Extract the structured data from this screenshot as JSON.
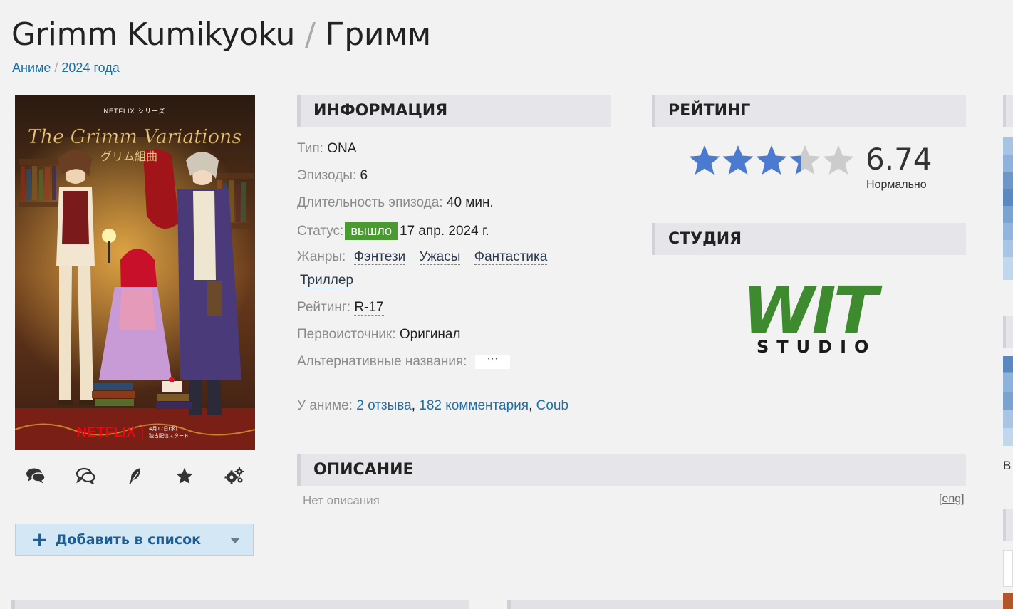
{
  "header": {
    "title_original": "Grimm Kumikyoku",
    "title_separator": "/",
    "title_russian": "Гримм",
    "breadcrumbs": [
      {
        "label": "Аниме"
      },
      {
        "label": "2024 года"
      }
    ],
    "breadcrumb_separator": "/"
  },
  "poster": {
    "label_top": "NETFLIX シリーズ",
    "logo_text": "The Grimm Variations",
    "logo_jp": "グリム組曲",
    "brand": "NETFLIX",
    "date_jp_line1": "4月17日(水)",
    "date_jp_line2": "独占配信スタート"
  },
  "actions": {
    "icons": [
      "comments-icon",
      "discussion-icon",
      "feather-icon",
      "star-icon",
      "gears-icon"
    ],
    "add_button": "Добавить в список"
  },
  "info": {
    "heading": "ИНФОРМАЦИЯ",
    "type_label": "Тип:",
    "type_value": "ONA",
    "episodes_label": "Эпизоды:",
    "episodes_value": "6",
    "duration_label": "Длительность эпизода:",
    "duration_value": "40 мин.",
    "status_label": "Статус:",
    "status_badge": "вышло",
    "status_date": "17 апр. 2024 г.",
    "genres_label": "Жанры:",
    "genres": [
      "Фэнтези",
      "Ужасы",
      "Фантастика",
      "Триллер"
    ],
    "rating_label": "Рейтинг:",
    "rating_value": "R-17",
    "source_label": "Первоисточник:",
    "source_value": "Оригинал",
    "alt_names_label": "Альтернативные названия:",
    "alt_names_more": "···",
    "links_label": "У аниме:",
    "links": [
      "2 отзыва",
      "182 комментария",
      "Coub"
    ],
    "links_separator": ","
  },
  "rating": {
    "heading": "РЕЙТИНГ",
    "score": "6.74",
    "stars_filled": 3.37,
    "stars_total": 5,
    "score_label": "Нормально",
    "star_color": "#4a7bd0",
    "star_empty_color": "#cccccc"
  },
  "studio": {
    "heading": "СТУДИЯ",
    "logo_main": "WIT",
    "logo_sub": "STUDIO",
    "logo_color": "#3e8a2e"
  },
  "description": {
    "heading": "ОПИСАНИЕ",
    "text": "Нет описания",
    "lang_link": "[eng]"
  },
  "colors": {
    "link": "#1d6fa7",
    "status_badge": "#4a9a32",
    "add_button_bg": "#d4e7f5",
    "add_button_text": "#1d5f95"
  },
  "right_edge": {
    "letter": "В"
  }
}
